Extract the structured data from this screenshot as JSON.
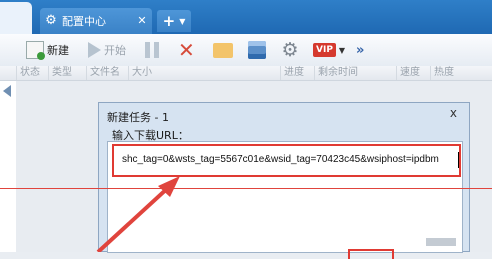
{
  "tabs": {
    "active_label": "配置中心",
    "active_icon": "gear-icon",
    "close_icon": "close-icon",
    "new_tab_icon": "plus-icon"
  },
  "toolbar": {
    "new_label": "新建",
    "start_label": "开始",
    "more_label": "»",
    "vip_label": "VIP"
  },
  "columns": [
    "状态",
    "类型",
    "文件名",
    "大小",
    "进度",
    "剩余时间",
    "速度",
    "热度"
  ],
  "dialog": {
    "title": "新建任务 - 1",
    "close_glyph": "x",
    "url_prompt": "输入下载URL：",
    "url_value": "shc_tag=0&wsts_tag=5567c01e&wsid_tag=70423c45&wsiphost=ipdbm"
  },
  "colors": {
    "tabbar": "#2a77c2",
    "highlight_red": "#e03a33",
    "dialog_bg": "#d6e3f1"
  }
}
